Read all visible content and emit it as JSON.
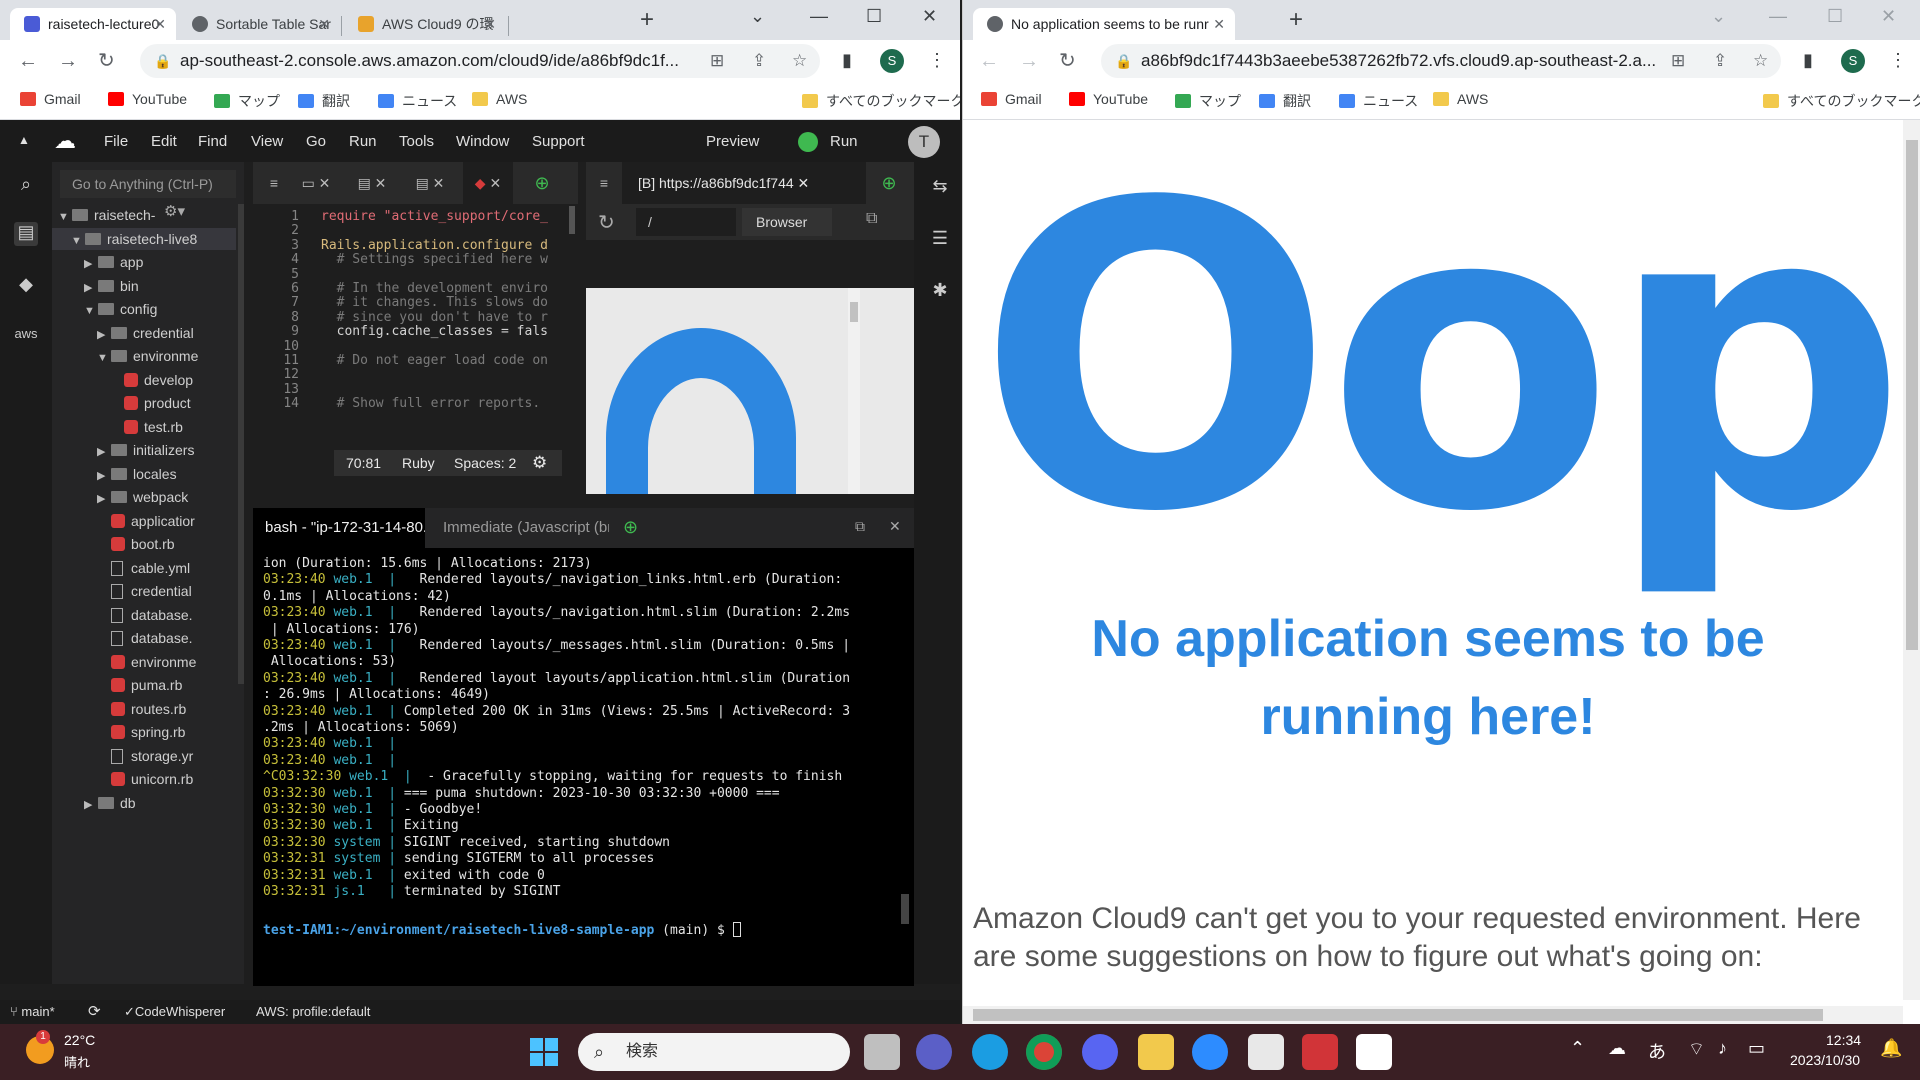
{
  "left_browser": {
    "tabs": [
      {
        "title": "raisetech-lecture0",
        "active": true
      },
      {
        "title": "Sortable Table Sar",
        "active": false
      },
      {
        "title": "AWS Cloud9 の環",
        "active": false
      }
    ],
    "url": "ap-southeast-2.console.aws.amazon.com/cloud9/ide/a86bf9dc1f...",
    "profile": "S"
  },
  "right_browser": {
    "tabs": [
      {
        "title": "No application seems to be runr",
        "active": true
      }
    ],
    "url": "a86bf9dc1f7443b3aeebe5387262fb72.vfs.cloud9.ap-southeast-2.a...",
    "profile": "S"
  },
  "bookmarks": {
    "items": [
      "Gmail",
      "YouTube",
      "マップ",
      "翻訳",
      "ニュース",
      "AWS"
    ],
    "all": "すべてのブックマーク"
  },
  "ide": {
    "menu": [
      "File",
      "Edit",
      "Find",
      "View",
      "Go",
      "Run",
      "Tools",
      "Window",
      "Support"
    ],
    "preview": "Preview",
    "run": "Run",
    "user_initial": "T",
    "goto_placeholder": "Go to Anything (Ctrl-P)",
    "tree": [
      {
        "label": "raisetech-",
        "type": "folder-open",
        "indent": 0
      },
      {
        "label": "raisetech-live8",
        "type": "folder-open",
        "indent": 1,
        "selected": true
      },
      {
        "label": "app",
        "type": "folder",
        "indent": 2
      },
      {
        "label": "bin",
        "type": "folder",
        "indent": 2
      },
      {
        "label": "config",
        "type": "folder-open",
        "indent": 2
      },
      {
        "label": "credential",
        "type": "folder",
        "indent": 3
      },
      {
        "label": "environme",
        "type": "folder-open",
        "indent": 3
      },
      {
        "label": "develop",
        "type": "ruby",
        "indent": 4
      },
      {
        "label": "product",
        "type": "ruby",
        "indent": 4
      },
      {
        "label": "test.rb",
        "type": "ruby",
        "indent": 4
      },
      {
        "label": "initializers",
        "type": "folder",
        "indent": 3
      },
      {
        "label": "locales",
        "type": "folder",
        "indent": 3
      },
      {
        "label": "webpack",
        "type": "folder",
        "indent": 3
      },
      {
        "label": "applicatior",
        "type": "ruby",
        "indent": 3
      },
      {
        "label": "boot.rb",
        "type": "ruby",
        "indent": 3
      },
      {
        "label": "cable.yml",
        "type": "doc",
        "indent": 3
      },
      {
        "label": "credential",
        "type": "doc",
        "indent": 3
      },
      {
        "label": "database.",
        "type": "doc",
        "indent": 3
      },
      {
        "label": "database.",
        "type": "doc",
        "indent": 3
      },
      {
        "label": "environme",
        "type": "ruby",
        "indent": 3
      },
      {
        "label": "puma.rb",
        "type": "ruby",
        "indent": 3
      },
      {
        "label": "routes.rb",
        "type": "ruby",
        "indent": 3
      },
      {
        "label": "spring.rb",
        "type": "ruby",
        "indent": 3
      },
      {
        "label": "storage.yr",
        "type": "doc",
        "indent": 3
      },
      {
        "label": "unicorn.rb",
        "type": "ruby",
        "indent": 3
      },
      {
        "label": "db",
        "type": "folder",
        "indent": 2
      }
    ],
    "code": [
      {
        "n": "1",
        "t": "require \"active_support/core_"
      },
      {
        "n": "2",
        "t": ""
      },
      {
        "n": "3",
        "t": "Rails.application.configure d"
      },
      {
        "n": "4",
        "t": "  # Settings specified here w"
      },
      {
        "n": "5",
        "t": ""
      },
      {
        "n": "6",
        "t": "  # In the development enviro"
      },
      {
        "n": "7",
        "t": "  # it changes. This slows do"
      },
      {
        "n": "8",
        "t": "  # since you don't have to r"
      },
      {
        "n": "9",
        "t": "  config.cache_classes = fals"
      },
      {
        "n": "10",
        "t": ""
      },
      {
        "n": "11",
        "t": "  # Do not eager load code on"
      },
      {
        "n": "12",
        "t": ""
      },
      {
        "n": "13",
        "t": ""
      },
      {
        "n": "14",
        "t": "  # Show full error reports."
      }
    ],
    "editor_status": {
      "position": "70:81",
      "mode": "Ruby",
      "spaces": "Spaces: 2"
    },
    "preview_tab": "[B] https://a86bf9dc1f744",
    "preview_path": "/",
    "preview_browser": "Browser",
    "terminal_tabs": [
      "bash - \"ip-172-31-14-80.a",
      "Immediate (Javascript (br"
    ],
    "terminal": [
      {
        "ts": "",
        "src": "",
        "msg": "ion (Duration: 15.6ms | Allocations: 2173)"
      },
      {
        "ts": "03:23:40",
        "src": "web.1",
        "msg": "   Rendered layouts/_navigation_links.html.erb (Duration:"
      },
      {
        "ts": "",
        "src": "",
        "msg": "0.1ms | Allocations: 42)"
      },
      {
        "ts": "03:23:40",
        "src": "web.1",
        "msg": "   Rendered layouts/_navigation.html.slim (Duration: 2.2ms"
      },
      {
        "ts": "",
        "src": "",
        "msg": " | Allocations: 176)"
      },
      {
        "ts": "03:23:40",
        "src": "web.1",
        "msg": "   Rendered layouts/_messages.html.slim (Duration: 0.5ms |"
      },
      {
        "ts": "",
        "src": "",
        "msg": " Allocations: 53)"
      },
      {
        "ts": "03:23:40",
        "src": "web.1",
        "msg": "   Rendered layout layouts/application.html.slim (Duration"
      },
      {
        "ts": "",
        "src": "",
        "msg": ": 26.9ms | Allocations: 4649)"
      },
      {
        "ts": "03:23:40",
        "src": "web.1",
        "msg": " Completed 200 OK in 31ms (Views: 25.5ms | ActiveRecord: 3"
      },
      {
        "ts": "",
        "src": "",
        "msg": ".2ms | Allocations: 5069)"
      },
      {
        "ts": "03:23:40",
        "src": "web.1",
        "msg": ""
      },
      {
        "ts": "03:23:40",
        "src": "web.1",
        "msg": ""
      },
      {
        "ts": "^C03:32:30",
        "src": "web.1",
        "msg": "  - Gracefully stopping, waiting for requests to finish"
      },
      {
        "ts": "03:32:30",
        "src": "web.1",
        "msg": " === puma shutdown: 2023-10-30 03:32:30 +0000 ==="
      },
      {
        "ts": "03:32:30",
        "src": "web.1",
        "msg": " - Goodbye!"
      },
      {
        "ts": "03:32:30",
        "src": "web.1",
        "msg": " Exiting"
      },
      {
        "ts": "03:32:30",
        "src": "system",
        "msg": " SIGINT received, starting shutdown"
      },
      {
        "ts": "03:32:31",
        "src": "system",
        "msg": " sending SIGTERM to all processes"
      },
      {
        "ts": "03:32:31",
        "src": "web.1",
        "msg": " exited with code 0"
      },
      {
        "ts": "03:32:31",
        "src": "js.1",
        "msg": " terminated by SIGINT"
      }
    ],
    "prompt": {
      "user": "test-IAM1",
      "path": ":~/environment/raisetech-live8-sample-app",
      "branch": " (main) $ "
    },
    "status": {
      "branch": "main*",
      "codewhisperer": "CodeWhisperer",
      "aws": "AWS: profile:default"
    }
  },
  "error_page": {
    "oops": "Oops",
    "heading": "No application seems to be running here!",
    "body": "Amazon Cloud9 can't get you to your requested environment. Here are some suggestions on how to figure out what's going on:"
  },
  "taskbar": {
    "weather_temp": "22°C",
    "weather_desc": "晴れ",
    "weather_badge": "1",
    "search_placeholder": "検索",
    "ime": "あ",
    "time": "12:34",
    "date": "2023/10/30"
  },
  "colors": {
    "accent": "#2d87e0",
    "terminal_timestamp": "#c7c03a",
    "terminal_source": "#3ab0c4",
    "taskbar": "#3a1f24"
  }
}
